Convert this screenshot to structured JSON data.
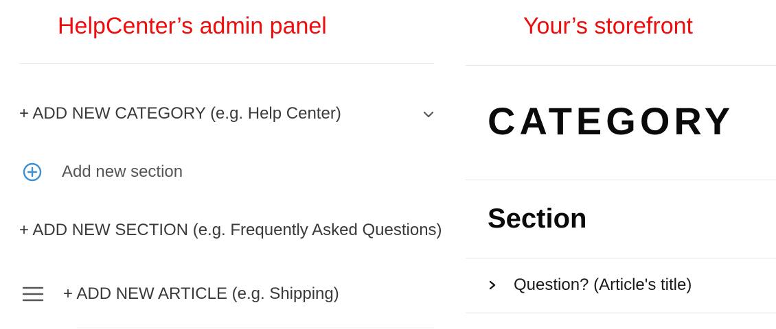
{
  "captions": {
    "admin": "HelpCenter’s admin panel",
    "storefront": "Your’s storefront"
  },
  "colors": {
    "caption": "#f00c0c",
    "accent": "#3d8fd1",
    "admin_text": "#3a3a3a",
    "store_text": "#0a0a0a"
  },
  "admin": {
    "category_row": {
      "label": "+ ADD NEW CATEGORY (e.g. Help Center)",
      "icon": "chevron-down-icon"
    },
    "add_section": {
      "label": "Add new section",
      "icon": "plus-circle-icon"
    },
    "section_row": {
      "label": "+ ADD NEW SECTION (e.g. Frequently Asked Questions)"
    },
    "article_row": {
      "label": "+ ADD NEW ARTICLE (e.g. Shipping)",
      "icon": "drag-handle-icon"
    }
  },
  "storefront": {
    "category": "CATEGORY",
    "section": "Section",
    "question": "Question? (Article's title)",
    "question_icon": "chevron-right-icon"
  }
}
